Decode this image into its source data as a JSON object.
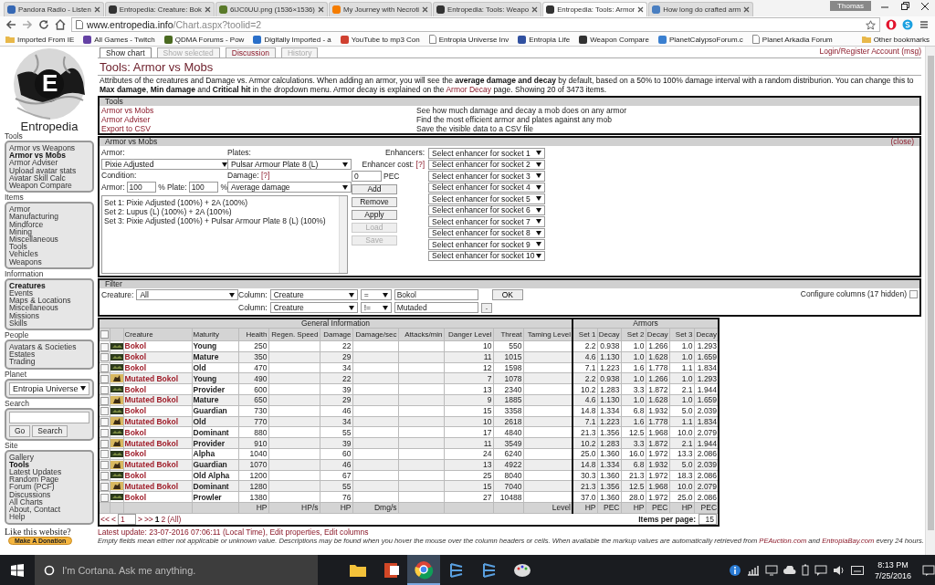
{
  "browser": {
    "tabs": [
      {
        "title": "Pandora Radio - Listen",
        "color": "#3668b4",
        "selected": false
      },
      {
        "title": "Entropedia: Creature: Bok",
        "color": "#333333",
        "selected": false
      },
      {
        "title": "6lJC0UU.png (1536×1536)",
        "color": "#5a7a2a",
        "selected": false
      },
      {
        "title": "My Journey with Necroti",
        "color": "#f57d00",
        "selected": false
      },
      {
        "title": "Entropedia: Tools: Weapo",
        "color": "#333333",
        "selected": false
      },
      {
        "title": "Entropedia: Tools: Armor",
        "color": "#333333",
        "selected": true
      },
      {
        "title": "How long do crafted arm",
        "color": "#4a7fc1",
        "selected": false
      }
    ],
    "profile": "Thomas",
    "address": {
      "host": "www.entropedia.info",
      "path": "/Chart.aspx?toolid=2"
    },
    "bookmarks": [
      {
        "label": "Imported From IE",
        "kind": "folder",
        "color": "#e8b84a"
      },
      {
        "label": "All Games - Twitch",
        "kind": "site",
        "color": "#6441a4"
      },
      {
        "label": "QDMA Forums - Pow",
        "kind": "site",
        "color": "#4a6a20"
      },
      {
        "label": "Digitally Imported - a",
        "kind": "site",
        "color": "#2a6fc9"
      },
      {
        "label": "YouTube to mp3 Con",
        "kind": "site",
        "color": "#d04030"
      },
      {
        "label": "Entropia Universe Inv",
        "kind": "page",
        "color": "#888888"
      },
      {
        "label": "Entropia Life",
        "kind": "site",
        "color": "#3050a0"
      },
      {
        "label": "Weapon Compare",
        "kind": "site",
        "color": "#333333"
      },
      {
        "label": "PlanetCalypsoForum.c",
        "kind": "site",
        "color": "#3a7fd0"
      },
      {
        "label": "Planet Arkadia Forum",
        "kind": "page",
        "color": "#888888"
      }
    ],
    "other_bookmarks": "Other bookmarks"
  },
  "sidebar": {
    "logo_letter": "E",
    "site_name": "Entropedia",
    "sections": [
      {
        "heading": "Tools",
        "kind": "links",
        "items": [
          {
            "label": "Armor vs Weapons",
            "selected": false
          },
          {
            "label": "Armor vs Mobs",
            "selected": true
          },
          {
            "label": "Armor Adviser",
            "selected": false
          },
          {
            "label": "Upload avatar stats",
            "selected": false
          },
          {
            "label": "Avatar Skill Calc",
            "selected": false
          },
          {
            "label": "Weapon Compare",
            "selected": false
          }
        ]
      },
      {
        "heading": "Items",
        "kind": "links",
        "items": [
          {
            "label": "Armor",
            "selected": false
          },
          {
            "label": "Manufacturing",
            "selected": false
          },
          {
            "label": "Mindforce",
            "selected": false
          },
          {
            "label": "Mining",
            "selected": false
          },
          {
            "label": "Miscellaneous",
            "selected": false
          },
          {
            "label": "Tools",
            "selected": false
          },
          {
            "label": "Vehicles",
            "selected": false
          },
          {
            "label": "Weapons",
            "selected": false
          }
        ]
      },
      {
        "heading": "Information",
        "kind": "links",
        "items": [
          {
            "label": "Creatures",
            "selected": true
          },
          {
            "label": "Events",
            "selected": false
          },
          {
            "label": "Maps & Locations",
            "selected": false
          },
          {
            "label": "Miscellaneous",
            "selected": false
          },
          {
            "label": "Missions",
            "selected": false
          },
          {
            "label": "Skills",
            "selected": false
          }
        ]
      },
      {
        "heading": "People",
        "kind": "links",
        "items": [
          {
            "label": "Avatars & Societies",
            "selected": false
          },
          {
            "label": "Estates",
            "selected": false
          },
          {
            "label": "Trading",
            "selected": false
          }
        ]
      },
      {
        "heading": "Planet",
        "kind": "select",
        "value": "Entropia Universe"
      },
      {
        "heading": "Search",
        "kind": "search",
        "buttons": [
          "Go",
          "Search"
        ]
      },
      {
        "heading": "Site",
        "kind": "links",
        "items": [
          {
            "label": "Gallery",
            "selected": false
          },
          {
            "label": "Tools",
            "selected": true
          },
          {
            "label": "Latest Updates",
            "selected": false
          },
          {
            "label": "Random Page",
            "selected": false
          },
          {
            "label": "Forum (PCF)",
            "selected": false
          },
          {
            "label": "Discussions",
            "selected": false
          },
          {
            "label": "All Charts",
            "selected": false
          },
          {
            "label": "About, Contact",
            "selected": false
          },
          {
            "label": "Help",
            "selected": false
          }
        ]
      }
    ],
    "like_text": "Like this website?",
    "donate_button": "Make A Donation"
  },
  "page_tabs": [
    {
      "label": "Show chart",
      "selected": true,
      "disabled": false
    },
    {
      "label": "Show selected",
      "selected": false,
      "disabled": true
    },
    {
      "label": "Discussion",
      "selected": false,
      "disabled": false
    },
    {
      "label": "History",
      "selected": false,
      "disabled": true
    }
  ],
  "login_link": "Login/Register Account (msg)",
  "title": "Tools: Armor vs Mobs",
  "description": [
    {
      "text": "Attributes of the creatures and Damage vs. Armor calculations. When adding an armor, you will see the **average damage and decay** by default, based on a 50% to 100% damage interval with a random distriburion. You can change this to **Max damage**, **Min damage** and **Critical hit** in the dropdown menu. Armor decay is explained on the "
    },
    {
      "link": "Armor Decay"
    },
    {
      "text": " page. Showing 20 of 3473 items."
    }
  ],
  "tools_panel": {
    "heading": "Tools",
    "rows": [
      {
        "link": "Armor vs Mobs",
        "description": "See how much damage and decay a mob does on any armor"
      },
      {
        "link": "Armor Adviser",
        "description": "Find the most efficient armor and plates against any mob"
      },
      {
        "link": "Export to CSV",
        "description": "Save the visible data to a CSV file"
      }
    ]
  },
  "armor_panel": {
    "heading": "Armor vs Mobs",
    "close": "(close)",
    "armor_label": "Armor:",
    "armor_value": "Pixie Adjusted",
    "plates_label": "Plates:",
    "plates_value": "Pulsar Armour Plate 8 (L)",
    "condition_label": "Condition:",
    "damage_label": "Damage:",
    "help_mark": "[?]",
    "armor_condition_label": "Armor:",
    "armor_condition": "100",
    "percent": "%",
    "plate_condition_label": "Plate:",
    "plate_condition": "100",
    "damage_value": "Average damage",
    "enhancers_label": "Enhancers:",
    "enhancer_cost_label": "Enhancer cost:",
    "enhancer_cost_help": "[?]",
    "enhancer_cost": "0",
    "enhancer_cost_unit": "PEC",
    "sets": [
      "Set 1: Pixie Adjusted (100%) + 2A (100%)",
      "Set 2: Lupus (L) (100%) + 2A (100%)",
      "Set 3: Pixie Adjusted (100%) + Pulsar Armour Plate 8 (L) (100%)"
    ],
    "buttons": [
      {
        "label": "Add",
        "disabled": false
      },
      {
        "label": "Remove",
        "disabled": false
      },
      {
        "label": "Apply",
        "disabled": false
      },
      {
        "label": "Load",
        "disabled": true
      },
      {
        "label": "Save",
        "disabled": true
      }
    ],
    "enhancers": [
      "Select enhancer for socket 1",
      "Select enhancer for socket 2",
      "Select enhancer for socket 3",
      "Select enhancer for socket 4",
      "Select enhancer for socket 5",
      "Select enhancer for socket 6",
      "Select enhancer for socket 7",
      "Select enhancer for socket 8",
      "Select enhancer for socket 9",
      "Select enhancer for socket 10"
    ]
  },
  "filter_panel": {
    "heading": "Filter",
    "creature_label": "Creature:",
    "creature_value": "All",
    "ok_button": "OK",
    "remove_button": "-",
    "conditions": [
      {
        "column_label": "Column:",
        "column": "Creature",
        "operator": "=",
        "value": "Bokol"
      },
      {
        "column_label": "Column:",
        "column": "Creature",
        "operator": "!=",
        "value": "Mutaded"
      }
    ],
    "configure_label": "Configure columns (17 hidden)",
    "configure_checked": false
  },
  "table": {
    "select_all_checked": false,
    "groups": [
      {
        "label": "General Information",
        "columns": [
          {
            "kind": "checkbox"
          },
          {
            "kind": "icon"
          },
          {
            "label": "Creature"
          },
          {
            "label": "Maturity"
          },
          {
            "label": "Health",
            "unit": "HP"
          },
          {
            "label": "Regen. Speed",
            "unit": "HP/s"
          },
          {
            "label": "Damage",
            "unit": "HP"
          },
          {
            "label": "Damage/sec",
            "unit": "Dmg/s"
          },
          {
            "label": "Attacks/min"
          },
          {
            "label": "Danger Level"
          },
          {
            "label": "Threat"
          },
          {
            "label": "Taming Level",
            "unit": "Level"
          }
        ]
      },
      {
        "label": "Armors",
        "columns": [
          {
            "label": "Set 1",
            "unit": "HP"
          },
          {
            "label": "Decay",
            "unit": "PEC"
          },
          {
            "label": "Set 2",
            "unit": "HP"
          },
          {
            "label": "Decay",
            "unit": "PEC"
          },
          {
            "label": "Set 3",
            "unit": "HP"
          },
          {
            "label": "Decay",
            "unit": "PEC"
          }
        ]
      }
    ],
    "rows": [
      {
        "checked": false,
        "kind": "bokol",
        "creature": "Bokol",
        "maturity": "Young",
        "health": "250",
        "damage": "22",
        "danger_level": "10",
        "threat": "550",
        "armors": [
          "2.2",
          "0.938",
          "1.0",
          "1.266",
          "1.0",
          "1.293"
        ]
      },
      {
        "checked": false,
        "kind": "bokol",
        "creature": "Bokol",
        "maturity": "Mature",
        "health": "350",
        "damage": "29",
        "danger_level": "11",
        "threat": "1015",
        "armors": [
          "4.6",
          "1.130",
          "1.0",
          "1.628",
          "1.0",
          "1.659"
        ]
      },
      {
        "checked": false,
        "kind": "bokol",
        "creature": "Bokol",
        "maturity": "Old",
        "health": "470",
        "damage": "34",
        "danger_level": "12",
        "threat": "1598",
        "armors": [
          "7.1",
          "1.223",
          "1.6",
          "1.778",
          "1.1",
          "1.834"
        ]
      },
      {
        "checked": false,
        "kind": "mutated",
        "creature": "Mutated Bokol",
        "maturity": "Young",
        "health": "490",
        "damage": "22",
        "danger_level": "7",
        "threat": "1078",
        "armors": [
          "2.2",
          "0.938",
          "1.0",
          "1.266",
          "1.0",
          "1.293"
        ]
      },
      {
        "checked": false,
        "kind": "bokol",
        "creature": "Bokol",
        "maturity": "Provider",
        "health": "600",
        "damage": "39",
        "danger_level": "13",
        "threat": "2340",
        "armors": [
          "10.2",
          "1.283",
          "3.3",
          "1.872",
          "2.1",
          "1.944"
        ]
      },
      {
        "checked": false,
        "kind": "mutated",
        "creature": "Mutated Bokol",
        "maturity": "Mature",
        "health": "650",
        "damage": "29",
        "danger_level": "9",
        "threat": "1885",
        "armors": [
          "4.6",
          "1.130",
          "1.0",
          "1.628",
          "1.0",
          "1.659"
        ]
      },
      {
        "checked": false,
        "kind": "bokol",
        "creature": "Bokol",
        "maturity": "Guardian",
        "health": "730",
        "damage": "46",
        "danger_level": "15",
        "threat": "3358",
        "armors": [
          "14.8",
          "1.334",
          "6.8",
          "1.932",
          "5.0",
          "2.039"
        ]
      },
      {
        "checked": false,
        "kind": "mutated",
        "creature": "Mutated Bokol",
        "maturity": "Old",
        "health": "770",
        "damage": "34",
        "danger_level": "10",
        "threat": "2618",
        "armors": [
          "7.1",
          "1.223",
          "1.6",
          "1.778",
          "1.1",
          "1.834"
        ]
      },
      {
        "checked": false,
        "kind": "bokol",
        "creature": "Bokol",
        "maturity": "Dominant",
        "health": "880",
        "damage": "55",
        "danger_level": "17",
        "threat": "4840",
        "armors": [
          "21.3",
          "1.356",
          "12.5",
          "1.968",
          "10.0",
          "2.079"
        ]
      },
      {
        "checked": false,
        "kind": "mutated",
        "creature": "Mutated Bokol",
        "maturity": "Provider",
        "health": "910",
        "damage": "39",
        "danger_level": "11",
        "threat": "3549",
        "armors": [
          "10.2",
          "1.283",
          "3.3",
          "1.872",
          "2.1",
          "1.944"
        ]
      },
      {
        "checked": false,
        "kind": "bokol",
        "creature": "Bokol",
        "maturity": "Alpha",
        "health": "1040",
        "damage": "60",
        "danger_level": "24",
        "threat": "6240",
        "armors": [
          "25.0",
          "1.360",
          "16.0",
          "1.972",
          "13.3",
          "2.086"
        ]
      },
      {
        "checked": false,
        "kind": "mutated",
        "creature": "Mutated Bokol",
        "maturity": "Guardian",
        "health": "1070",
        "damage": "46",
        "danger_level": "13",
        "threat": "4922",
        "armors": [
          "14.8",
          "1.334",
          "6.8",
          "1.932",
          "5.0",
          "2.039"
        ]
      },
      {
        "checked": false,
        "kind": "bokol",
        "creature": "Bokol",
        "maturity": "Old Alpha",
        "health": "1200",
        "damage": "67",
        "danger_level": "25",
        "threat": "8040",
        "armors": [
          "30.3",
          "1.360",
          "21.3",
          "1.972",
          "18.3",
          "2.086"
        ]
      },
      {
        "checked": false,
        "kind": "mutated",
        "creature": "Mutated Bokol",
        "maturity": "Dominant",
        "health": "1280",
        "damage": "55",
        "danger_level": "15",
        "threat": "7040",
        "armors": [
          "21.3",
          "1.356",
          "12.5",
          "1.968",
          "10.0",
          "2.079"
        ]
      },
      {
        "checked": false,
        "kind": "bokol",
        "creature": "Bokol",
        "maturity": "Prowler",
        "health": "1380",
        "damage": "76",
        "danger_level": "27",
        "threat": "10488",
        "armors": [
          "37.0",
          "1.360",
          "28.0",
          "1.972",
          "25.0",
          "2.086"
        ]
      }
    ],
    "pager": {
      "first": "<<",
      "prev": "<",
      "page": "1",
      "next": ">",
      "last": ">>",
      "pages": [
        {
          "label": "1",
          "selected": true
        },
        {
          "label": "2",
          "selected": false
        },
        {
          "label": "(All)",
          "selected": false
        }
      ]
    },
    "items_per_page_label": "Items per page:",
    "items_per_page": "15"
  },
  "footer": {
    "update": [
      {
        "text": "Latest update: 23-07-2016 07:06:11 (Local Time), "
      },
      {
        "link": "Edit properties"
      },
      {
        "text": ", "
      },
      {
        "link": "Edit columns"
      }
    ],
    "note": [
      {
        "text": "Empty fields mean either not applicable or unknown value. Descriptions may be found when you hover the mouse over the column headers or cells. When available the markup values are automatically retrieved from "
      },
      {
        "link": "PEAuction.com"
      },
      {
        "text": " and "
      },
      {
        "link": "EntropiaBay.com"
      },
      {
        "text": " every 24 hours."
      }
    ]
  },
  "taskbar": {
    "search_placeholder": "I'm Cortana. Ask me anything.",
    "apps": [
      {
        "kind": "folder",
        "selected": false
      },
      {
        "kind": "slides",
        "selected": false
      },
      {
        "kind": "browser",
        "selected": true
      },
      {
        "kind": "letter",
        "selected": false
      },
      {
        "kind": "letter",
        "selected": false
      },
      {
        "kind": "palette",
        "selected": false
      }
    ],
    "time": "8:13 PM",
    "date": "7/25/2016"
  }
}
